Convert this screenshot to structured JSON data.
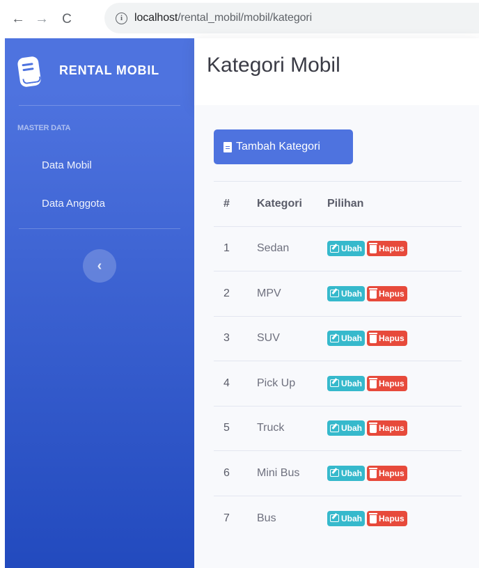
{
  "browser": {
    "url_host": "localhost",
    "url_path": "/rental_mobil/mobil/kategori"
  },
  "sidebar": {
    "brand": "RENTAL MOBIL",
    "heading": "MASTER DATA",
    "items": [
      {
        "label": "Data Mobil"
      },
      {
        "label": "Data Anggota"
      }
    ]
  },
  "header": {
    "title": "Kategori Mobil"
  },
  "main": {
    "add_button": "Tambah Kategori",
    "table": {
      "headers": [
        "#",
        "Kategori",
        "Pilihan"
      ],
      "rows": [
        {
          "no": "1",
          "kategori": "Sedan"
        },
        {
          "no": "2",
          "kategori": "MPV"
        },
        {
          "no": "3",
          "kategori": "SUV"
        },
        {
          "no": "4",
          "kategori": "Pick Up"
        },
        {
          "no": "5",
          "kategori": "Truck"
        },
        {
          "no": "6",
          "kategori": "Mini Bus"
        },
        {
          "no": "7",
          "kategori": "Bus"
        }
      ],
      "edit_label": "Ubah",
      "delete_label": "Hapus"
    }
  },
  "colors": {
    "primary": "#4e73df",
    "info": "#36b9cc",
    "danger": "#e74a3b"
  }
}
